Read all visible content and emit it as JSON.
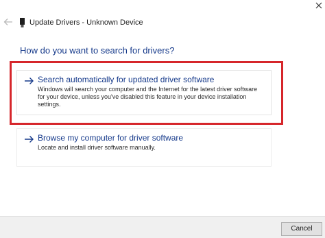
{
  "window": {
    "title": "Update Drivers - Unknown Device",
    "back_icon": "back-arrow-icon",
    "device_icon": "usb-device-icon"
  },
  "main": {
    "heading": "How do you want to search for drivers?",
    "options": [
      {
        "title": "Search automatically for updated driver software",
        "description": "Windows will search your computer and the Internet for the latest driver software for your device, unless you've disabled this feature in your device installation settings.",
        "icon": "right-arrow-icon",
        "highlighted": true
      },
      {
        "title": "Browse my computer for driver software",
        "description": "Locate and install driver software manually.",
        "icon": "right-arrow-icon",
        "highlighted": false
      }
    ]
  },
  "footer": {
    "cancel_label": "Cancel"
  },
  "colors": {
    "link_blue": "#15398a",
    "highlight_red": "#d6262b",
    "footer_bg": "#f0f0f0"
  }
}
